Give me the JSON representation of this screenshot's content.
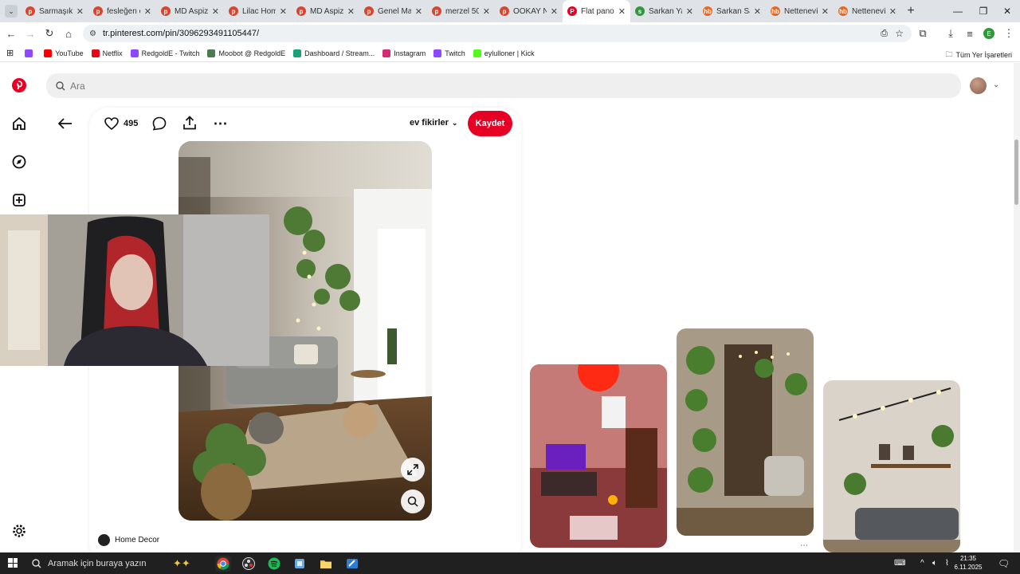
{
  "tabs": [
    {
      "title": "Sarmaşık i",
      "favicon_color": "#d9462f",
      "favicon": "p"
    },
    {
      "title": "fesleğen ç",
      "favicon_color": "#d9462f",
      "favicon": "p"
    },
    {
      "title": "MD Aspiz",
      "favicon_color": "#d9462f",
      "favicon": "p"
    },
    {
      "title": "Lilac Home",
      "favicon_color": "#d9462f",
      "favicon": "p"
    },
    {
      "title": "MD Aspiz",
      "favicon_color": "#d9462f",
      "favicon": "p"
    },
    {
      "title": "Genel Mar",
      "favicon_color": "#d9462f",
      "favicon": "p"
    },
    {
      "title": "merzel 50",
      "favicon_color": "#d9462f",
      "favicon": "p"
    },
    {
      "title": "OOKAY Ne",
      "favicon_color": "#d9462f",
      "favicon": "p"
    },
    {
      "title": "Flat panos",
      "favicon_color": "#e60023",
      "favicon": "P",
      "active": true
    },
    {
      "title": "Sarkan Ya",
      "favicon_color": "#2e9a3a",
      "favicon": "s"
    },
    {
      "title": "Sarkan Sa",
      "favicon_color": "#e8651c",
      "favicon": "hb"
    },
    {
      "title": "Netteneví",
      "favicon_color": "#e8651c",
      "favicon": "hb"
    },
    {
      "title": "Netteneví",
      "favicon_color": "#e8651c",
      "favicon": "hb"
    }
  ],
  "url": "tr.pinterest.com/pin/3096293491105447/",
  "bookmarks": [
    {
      "label": "",
      "color": "#9146ff"
    },
    {
      "label": "YouTube",
      "color": "#ff0000"
    },
    {
      "label": "Netflix",
      "color": "#e50914"
    },
    {
      "label": "RedgoldE - Twitch",
      "color": "#9146ff"
    },
    {
      "label": "Moobot @ RedgoldE",
      "color": "#4a7a50"
    },
    {
      "label": "Dashboard / Stream...",
      "color": "#1aa37a"
    },
    {
      "label": "Instagram",
      "color": "#d62976"
    },
    {
      "label": "Twitch",
      "color": "#9146ff"
    },
    {
      "label": "eylulloner | Kick",
      "color": "#53fc18"
    }
  ],
  "all_bookmarks_label": "Tüm Yer İşaretleri",
  "search_placeholder": "Ara",
  "pin": {
    "like_count": "495",
    "board": "ev fikirler",
    "save_label": "Kaydet",
    "author": "Home Decor"
  },
  "taskbar": {
    "search_placeholder": "Aramak için buraya yazın",
    "time": "21:35",
    "date": "6.11.2025"
  },
  "colors": {
    "brand": "#e60023",
    "chrome_bg": "#dfe3e8",
    "taskbar_bg": "#202020"
  }
}
